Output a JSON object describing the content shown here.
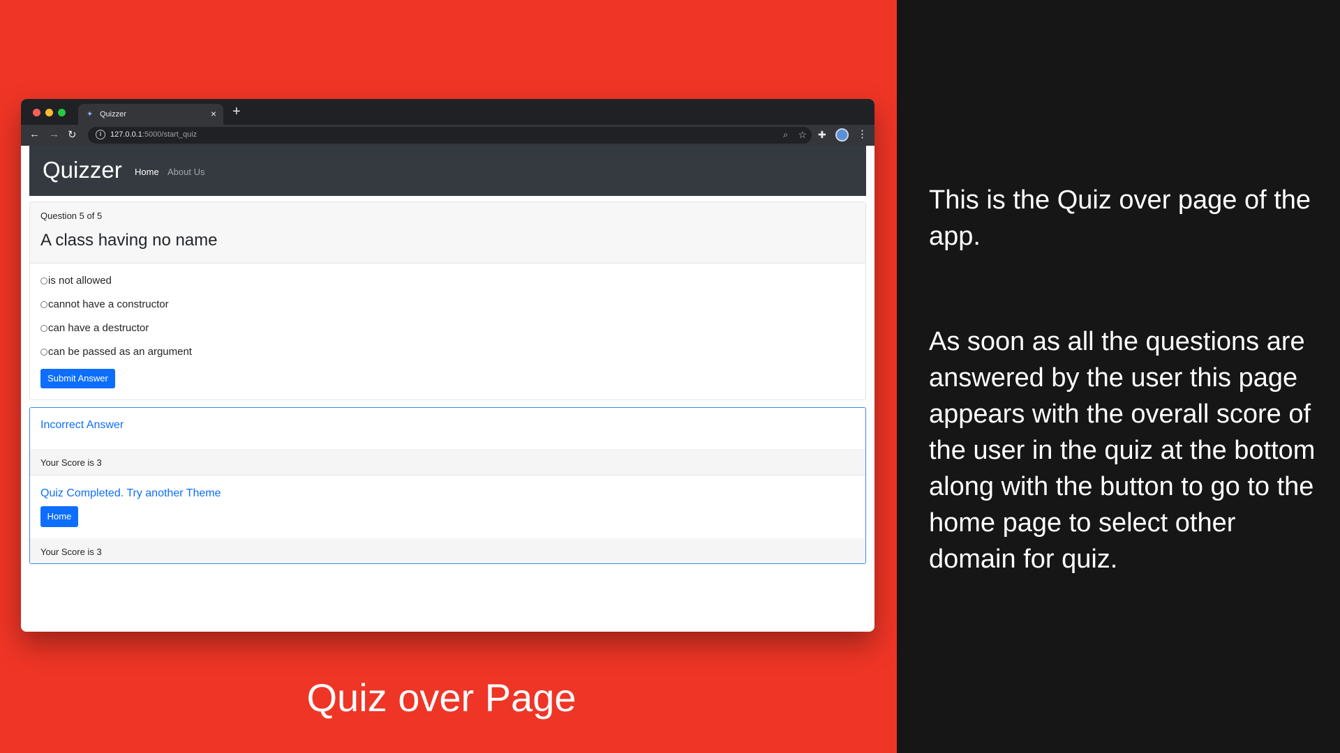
{
  "browser": {
    "tab_title": "Quizzer",
    "tab_close": "×",
    "new_tab": "+",
    "url_host": "127.0.0.1",
    "url_path": ":5000/start_quiz"
  },
  "navbar": {
    "brand": "Quizzer",
    "links": [
      "Home",
      "About Us"
    ]
  },
  "question": {
    "counter": "Question 5 of 5",
    "title": "A class having no name",
    "options": [
      "is not allowed",
      "cannot have a constructor",
      "can have a destructor",
      "can be passed as an argument"
    ],
    "submit_label": "Submit Answer"
  },
  "result": {
    "title": "Incorrect Answer",
    "score_text": "Your Score is 3",
    "completed_title": "Quiz Completed. Try another Theme",
    "home_label": "Home",
    "final_score_text": "Your Score is 3"
  },
  "caption": "Quiz over Page",
  "description": {
    "paragraph1": "This is the Quiz over page of the app.",
    "paragraph2": "As soon as all the questions are answered by the user this page appears with the overall score of the user in the quiz at the bottom along with the button to go to the home page to select other domain for quiz."
  },
  "colors": {
    "background_left": "#ef3526",
    "background_right": "#161616",
    "navbar": "#343a40",
    "primary": "#0d6efd"
  },
  "icons": [
    "back-arrow-icon",
    "forward-arrow-icon",
    "reload-icon",
    "info-icon",
    "zoom-icon",
    "star-icon",
    "puzzle-icon",
    "profile-icon",
    "kebab-menu-icon"
  ]
}
